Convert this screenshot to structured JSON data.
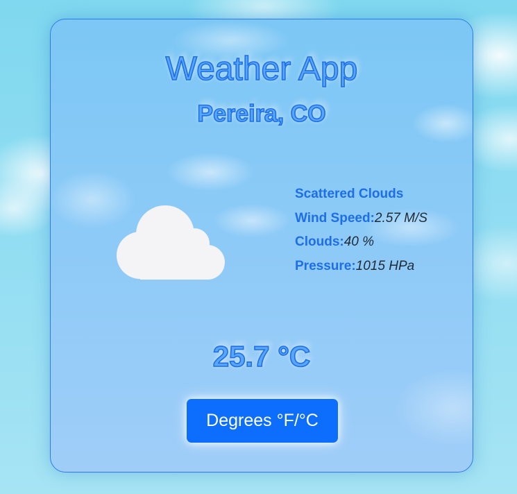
{
  "header": {
    "title": "Weather App",
    "city": "Pereira, CO"
  },
  "weather": {
    "icon": "cloud-icon",
    "description": "Scattered Clouds",
    "wind_speed_label": "Wind Speed:",
    "wind_speed_value": "2.57 M/S",
    "clouds_label": "Clouds:",
    "clouds_value": "40 %",
    "pressure_label": "Pressure:",
    "pressure_value": "1015 HPa",
    "temperature": "25.7 °C"
  },
  "controls": {
    "toggle_units_label": "Degrees °F/°C"
  },
  "colors": {
    "accent": "#0d6efd",
    "label_blue": "#1e6ee6",
    "card_border": "#2f7be6"
  }
}
